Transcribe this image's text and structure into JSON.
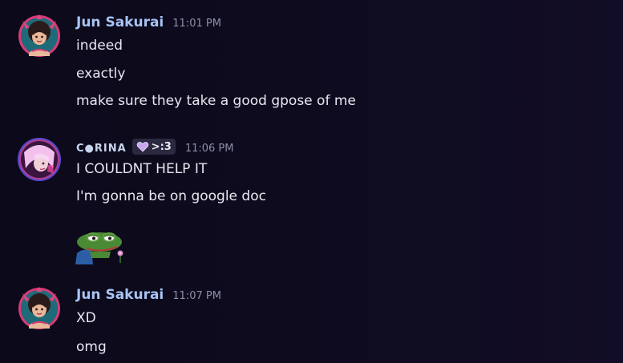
{
  "messages": [
    {
      "username": "Jun Sakurai",
      "timestamp": "11:01 PM",
      "avatar_icon": "devil-girl-avatar",
      "lines": [
        "indeed",
        "exactly",
        "make sure they take a good gpose of me"
      ]
    },
    {
      "username": "C●RINA",
      "timestamp": "11:06 PM",
      "avatar_icon": "pink-hair-avatar",
      "tag": {
        "icon": "heart-icon",
        "text": ">:3",
        "color": "#c9a6f0"
      },
      "lines": [
        "I COULDNT HELP IT",
        "I'm gonna be on google doc"
      ],
      "emoji": "pepe-flower-emoji"
    },
    {
      "username": "Jun Sakurai",
      "timestamp": "11:07 PM",
      "avatar_icon": "devil-girl-avatar",
      "lines": [
        "XD",
        "omg"
      ]
    }
  ],
  "colors": {
    "background": "#0e0b1f",
    "username_jun": "#a8c4f4",
    "username_corina": "#c9d4ee",
    "timestamp": "#8d8fa6",
    "text": "#e8e8f0",
    "avatar_ring": "#d83a78"
  }
}
